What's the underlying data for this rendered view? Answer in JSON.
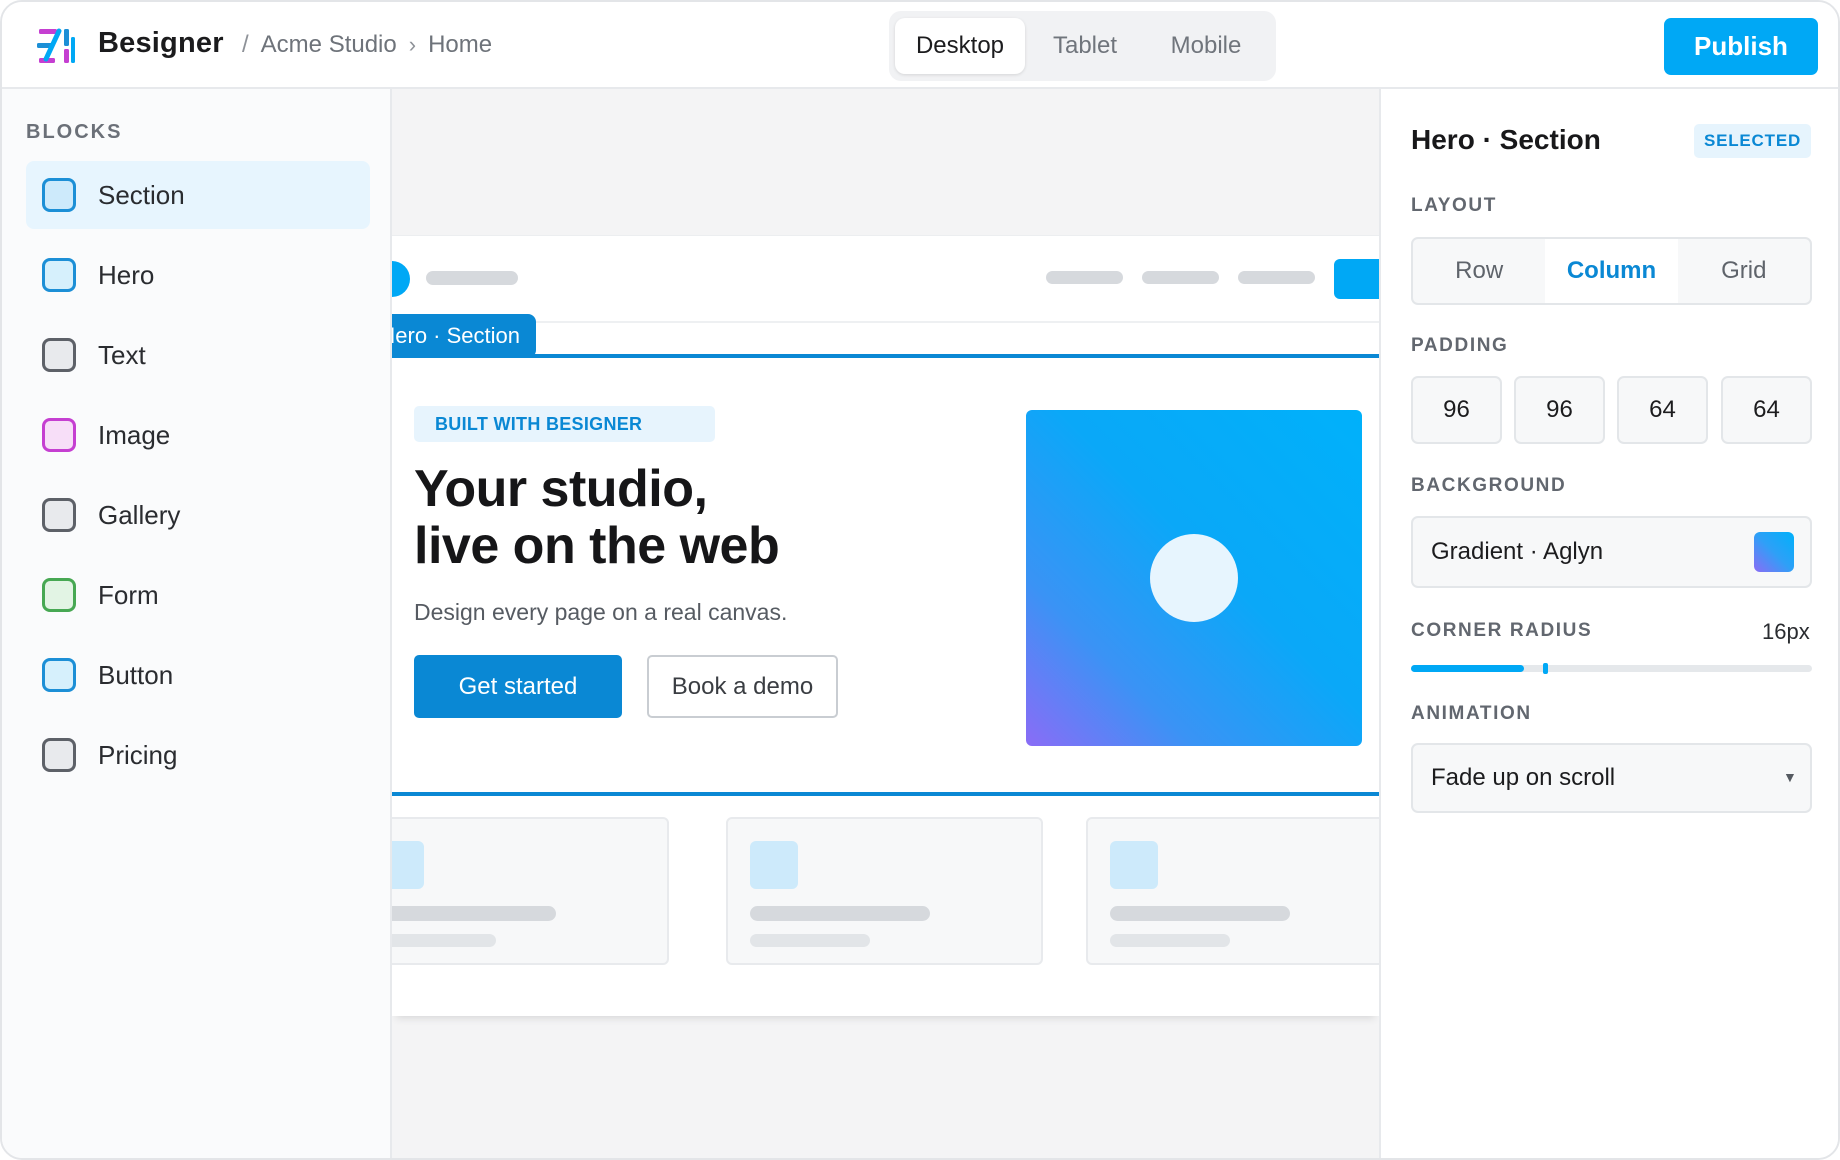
{
  "app": {
    "name": "Besigner",
    "brand_color": "#00a8f5",
    "accent_color": "#0a88d4"
  },
  "breadcrumb": {
    "separator": "/",
    "items": [
      "Acme Studio",
      "Home"
    ],
    "chevron": "›"
  },
  "device_toggle": {
    "options": [
      "Desktop",
      "Tablet",
      "Mobile"
    ],
    "selected": "Desktop"
  },
  "toolbar": {
    "publish_label": "Publish"
  },
  "sidebar": {
    "title": "BLOCKS",
    "items": [
      {
        "label": "Section",
        "icon": "block-swatch-icon",
        "fill": "#cdeafb",
        "stroke": "#1c8fd6",
        "active": true
      },
      {
        "label": "Hero",
        "icon": "block-swatch-icon",
        "fill": "#d6f0fc",
        "stroke": "#1c8fd6",
        "active": false
      },
      {
        "label": "Text",
        "icon": "block-swatch-icon",
        "fill": "#e8eaed",
        "stroke": "#5d6168",
        "active": false
      },
      {
        "label": "Image",
        "icon": "block-swatch-icon",
        "fill": "#f7def8",
        "stroke": "#c53fd1",
        "active": false
      },
      {
        "label": "Gallery",
        "icon": "block-swatch-icon",
        "fill": "#e8eaed",
        "stroke": "#5d6168",
        "active": false
      },
      {
        "label": "Form",
        "icon": "block-swatch-icon",
        "fill": "#e2f4e4",
        "stroke": "#47a853",
        "active": false
      },
      {
        "label": "Button",
        "icon": "block-swatch-icon",
        "fill": "#d6f0fc",
        "stroke": "#1c8fd6",
        "active": false
      },
      {
        "label": "Pricing",
        "icon": "block-swatch-icon",
        "fill": "#e8eaed",
        "stroke": "#5d6168",
        "active": false
      }
    ]
  },
  "canvas": {
    "selection_tag": "Hero · Section",
    "hero": {
      "eyebrow": "BUILT WITH BESIGNER",
      "heading_line1": "Your studio,",
      "heading_line2": "live on the web",
      "subtitle": "Design every page on a real canvas.",
      "primary_cta": "Get started",
      "secondary_cta": "Book a demo"
    }
  },
  "inspector": {
    "title": "Hero · Section",
    "badge": "SELECTED",
    "layout": {
      "label": "LAYOUT",
      "options": [
        "Row",
        "Column",
        "Grid"
      ],
      "selected": "Column"
    },
    "padding": {
      "label": "PADDING",
      "values": [
        "96",
        "96",
        "64",
        "64"
      ]
    },
    "background": {
      "label": "BACKGROUND",
      "value": "Gradient · Aglyn"
    },
    "corner_radius": {
      "label": "CORNER RADIUS",
      "value": "16px",
      "level": 0.33
    },
    "animation": {
      "label": "ANIMATION",
      "value": "Fade up on scroll"
    }
  }
}
